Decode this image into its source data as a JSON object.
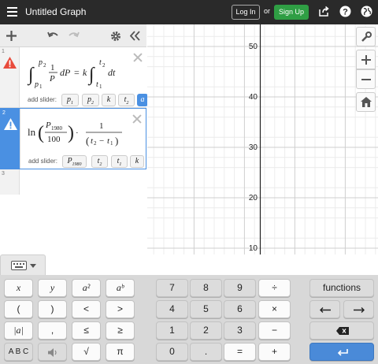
{
  "header": {
    "title": "Untitled Graph",
    "login": "Log In",
    "or": "or",
    "signup": "Sign Up"
  },
  "expressions": [
    {
      "index": "1",
      "add_slider_label": "add slider:",
      "sliders": [
        "p1",
        "p2",
        "k",
        "t2",
        "a"
      ]
    },
    {
      "index": "2",
      "add_slider_label": "add slider:",
      "sliders": [
        "P1980",
        "t2",
        "t1",
        "k"
      ]
    },
    {
      "index": "3"
    }
  ],
  "graph": {
    "y_ticks": [
      "50",
      "40",
      "30",
      "20",
      "10"
    ]
  },
  "keypad": {
    "functions": "functions",
    "abc": "A B C",
    "left": [
      [
        "x",
        "y",
        "a²",
        "aᵇ"
      ],
      [
        "(",
        ")",
        "<",
        ">"
      ],
      [
        "|a|",
        ",",
        "≤",
        "≥"
      ]
    ],
    "numpad": [
      [
        "7",
        "8",
        "9",
        "÷"
      ],
      [
        "4",
        "5",
        "6",
        "×"
      ],
      [
        "1",
        "2",
        "3",
        "−"
      ],
      [
        "0",
        ".",
        "=",
        "+"
      ]
    ],
    "sqrt": "√",
    "pi": "π"
  },
  "colors": {
    "accent": "#4a90e2",
    "signup": "#2f9e44",
    "header": "#2a2a2a"
  }
}
